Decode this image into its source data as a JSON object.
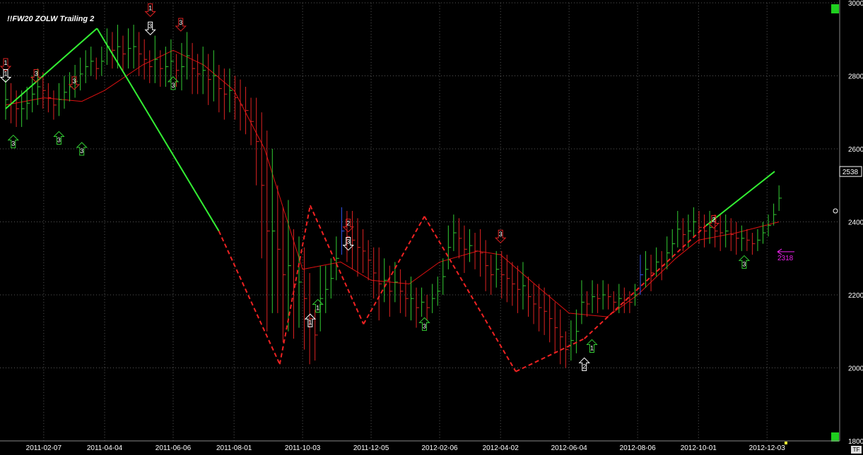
{
  "title": "!!FW20 ZOLW Trailing 2",
  "last_price_label": "2538",
  "target_label": "2318",
  "tf_label": "TF",
  "colors": {
    "background": "#000000",
    "up_bar": "#33cc33",
    "down_bar": "#dd2222",
    "zigzag_up": "#33ee33",
    "zigzag_down": "#ee2222",
    "ma": "#dd1111",
    "grid": "#555555",
    "target": "#ee22ee",
    "neutral_bar": "#3355ee"
  },
  "chart_data": {
    "type": "ohlc",
    "instrument": "!!FW20 ZOLW Trailing 2",
    "xlabels": [
      "2011-02-07",
      "2011-04-04",
      "2011-06-06",
      "2011-08-01",
      "2011-10-03",
      "2011-12-05",
      "2012-02-06",
      "2012-04-02",
      "2012-06-04",
      "2012-08-06",
      "2012-10-01",
      "2012-12-03"
    ],
    "ylabels": [
      3000,
      2800,
      2600,
      2400,
      2200,
      2000,
      1800
    ],
    "ylim": [
      1800,
      3000
    ],
    "grid": true,
    "last_price": 2538,
    "target_price": 2318,
    "price_bars": {
      "date_range": [
        "2011-01-03",
        "2012-12-14"
      ],
      "highs": [
        2790,
        2780,
        2760,
        2760,
        2770,
        2800,
        2820,
        2810,
        2780,
        2760,
        2780,
        2800,
        2810,
        2830,
        2850,
        2870,
        2880,
        2850,
        2880,
        2930,
        2920,
        2940,
        2910,
        2930,
        2940,
        2920,
        2900,
        2870,
        2910,
        2870,
        2880,
        2900,
        2860,
        2890,
        2920,
        2890,
        2860,
        2880,
        2860,
        2870,
        2830,
        2820,
        2820,
        2800,
        2790,
        2770,
        2740,
        2740,
        2700,
        2650,
        2600,
        2500,
        2440,
        2460,
        2380,
        2360,
        2330,
        2260,
        2160,
        2280,
        2280,
        2300,
        2360,
        2440,
        2430,
        2430,
        2410,
        2380,
        2350,
        2330,
        2330,
        2300,
        2280,
        2290,
        2270,
        2240,
        2250,
        2220,
        2220,
        2200,
        2230,
        2250,
        2300,
        2390,
        2420,
        2410,
        2390,
        2380,
        2370,
        2380,
        2350,
        2310,
        2320,
        2320,
        2310,
        2290,
        2280,
        2290,
        2250,
        2230,
        2230,
        2220,
        2200,
        2180,
        2160,
        2100,
        2130,
        2160,
        2240,
        2210,
        2240,
        2230,
        2240,
        2230,
        2210,
        2230,
        2220,
        2210,
        2230,
        2310,
        2320,
        2310,
        2330,
        2320,
        2360,
        2380,
        2430,
        2410,
        2420,
        2440,
        2430,
        2420,
        2430,
        2420,
        2420,
        2420,
        2410,
        2400,
        2390,
        2380,
        2370,
        2380,
        2400,
        2420,
        2450,
        2500
      ],
      "lows": [
        2680,
        2670,
        2660,
        2660,
        2680,
        2700,
        2720,
        2710,
        2700,
        2680,
        2690,
        2710,
        2730,
        2740,
        2760,
        2780,
        2800,
        2790,
        2800,
        2830,
        2820,
        2820,
        2810,
        2820,
        2820,
        2800,
        2790,
        2780,
        2780,
        2770,
        2770,
        2780,
        2770,
        2760,
        2790,
        2750,
        2750,
        2750,
        2720,
        2730,
        2700,
        2680,
        2700,
        2680,
        2650,
        2640,
        2610,
        2500,
        2300,
        2100,
        2150,
        2150,
        2070,
        2100,
        2080,
        2110,
        2050,
        2010,
        2020,
        2100,
        2150,
        2190,
        2240,
        2310,
        2290,
        2270,
        2250,
        2260,
        2240,
        2190,
        2130,
        2180,
        2140,
        2180,
        2150,
        2140,
        2130,
        2110,
        2140,
        2130,
        2150,
        2170,
        2200,
        2270,
        2320,
        2300,
        2260,
        2290,
        2270,
        2250,
        2210,
        2200,
        2220,
        2190,
        2180,
        2170,
        2150,
        2160,
        2140,
        2120,
        2100,
        2090,
        2070,
        2040,
        2010,
        2000,
        2020,
        2040,
        2120,
        2140,
        2150,
        2150,
        2160,
        2160,
        2150,
        2150,
        2150,
        2150,
        2170,
        2200,
        2220,
        2210,
        2250,
        2240,
        2270,
        2300,
        2330,
        2320,
        2330,
        2360,
        2340,
        2330,
        2340,
        2330,
        2320,
        2330,
        2320,
        2310,
        2320,
        2320,
        2310,
        2320,
        2340,
        2360,
        2390,
        2430
      ]
    },
    "zigzag": [
      {
        "date": "2011-01-03",
        "value": 2710,
        "style": "solid",
        "color": "up"
      },
      {
        "date": "2011-03-28",
        "value": 2930,
        "style": "solid",
        "color": "up"
      },
      {
        "date": "2011-07-18",
        "value": 2375,
        "style": "solid",
        "color": "up"
      },
      {
        "date": "2011-09-12",
        "value": 2010,
        "style": "dashed",
        "color": "down"
      },
      {
        "date": "2011-10-10",
        "value": 2445,
        "style": "dashed",
        "color": "down"
      },
      {
        "date": "2011-11-28",
        "value": 2120,
        "style": "dashed",
        "color": "down"
      },
      {
        "date": "2012-01-23",
        "value": 2415,
        "style": "dashed",
        "color": "down"
      },
      {
        "date": "2012-04-16",
        "value": 1990,
        "style": "dashed",
        "color": "down"
      },
      {
        "date": "2012-06-18",
        "value": 2080,
        "style": "dashed",
        "color": "down"
      },
      {
        "date": "2012-10-08",
        "value": 2390,
        "style": "dashed",
        "color": "down"
      },
      {
        "date": "2012-12-10",
        "value": 2538,
        "style": "solid",
        "color": "up"
      }
    ],
    "moving_average": [
      {
        "date": "2011-01-03",
        "value": 2720
      },
      {
        "date": "2011-02-07",
        "value": 2740
      },
      {
        "date": "2011-03-14",
        "value": 2730
      },
      {
        "date": "2011-04-04",
        "value": 2760
      },
      {
        "date": "2011-05-09",
        "value": 2830
      },
      {
        "date": "2011-06-06",
        "value": 2870
      },
      {
        "date": "2011-07-04",
        "value": 2830
      },
      {
        "date": "2011-08-01",
        "value": 2760
      },
      {
        "date": "2011-08-29",
        "value": 2600
      },
      {
        "date": "2011-10-03",
        "value": 2270
      },
      {
        "date": "2011-11-07",
        "value": 2290
      },
      {
        "date": "2011-12-05",
        "value": 2240
      },
      {
        "date": "2012-01-09",
        "value": 2230
      },
      {
        "date": "2012-02-06",
        "value": 2290
      },
      {
        "date": "2012-03-12",
        "value": 2320
      },
      {
        "date": "2012-04-02",
        "value": 2310
      },
      {
        "date": "2012-05-07",
        "value": 2220
      },
      {
        "date": "2012-06-04",
        "value": 2150
      },
      {
        "date": "2012-07-09",
        "value": 2140
      },
      {
        "date": "2012-08-06",
        "value": 2200
      },
      {
        "date": "2012-09-10",
        "value": 2300
      },
      {
        "date": "2012-10-01",
        "value": 2350
      },
      {
        "date": "2012-11-05",
        "value": 2370
      },
      {
        "date": "2012-12-14",
        "value": 2400
      }
    ],
    "signals": [
      {
        "date": "2011-01-03",
        "value": 2830,
        "dir": "down",
        "label": "1",
        "color": "#dd2222"
      },
      {
        "date": "2011-01-03",
        "value": 2800,
        "dir": "down",
        "label": "1",
        "color": "#ffffff"
      },
      {
        "date": "2011-01-10",
        "value": 2620,
        "dir": "up",
        "label": "3",
        "color": "#33cc33"
      },
      {
        "date": "2011-01-31",
        "value": 2800,
        "dir": "down",
        "label": "3",
        "color": "#dd2222"
      },
      {
        "date": "2011-02-21",
        "value": 2630,
        "dir": "up",
        "label": "3",
        "color": "#33cc33"
      },
      {
        "date": "2011-03-07",
        "value": 2780,
        "dir": "down",
        "label": "3",
        "color": "#dd2222"
      },
      {
        "date": "2011-03-14",
        "value": 2600,
        "dir": "up",
        "label": "3",
        "color": "#33cc33"
      },
      {
        "date": "2011-05-16",
        "value": 2980,
        "dir": "down",
        "label": "1",
        "color": "#dd2222"
      },
      {
        "date": "2011-05-16",
        "value": 2930,
        "dir": "down",
        "label": "3",
        "color": "#ffffff"
      },
      {
        "date": "2011-06-13",
        "value": 2940,
        "dir": "down",
        "label": "3",
        "color": "#dd2222"
      },
      {
        "date": "2011-06-06",
        "value": 2780,
        "dir": "up",
        "label": "3",
        "color": "#33cc33"
      },
      {
        "date": "2011-10-10",
        "value": 2130,
        "dir": "up",
        "label": "1",
        "color": "#ffffff"
      },
      {
        "date": "2011-10-17",
        "value": 2170,
        "dir": "up",
        "label": "1",
        "color": "#33cc33"
      },
      {
        "date": "2011-11-14",
        "value": 2390,
        "dir": "down",
        "label": "2",
        "color": "#dd2222"
      },
      {
        "date": "2011-11-14",
        "value": 2340,
        "dir": "down",
        "label": "3",
        "color": "#ffffff"
      },
      {
        "date": "2012-01-23",
        "value": 2120,
        "dir": "up",
        "label": "3",
        "color": "#33cc33"
      },
      {
        "date": "2012-04-02",
        "value": 2360,
        "dir": "down",
        "label": "3",
        "color": "#dd2222"
      },
      {
        "date": "2012-06-18",
        "value": 2010,
        "dir": "up",
        "label": "2",
        "color": "#ffffff"
      },
      {
        "date": "2012-06-25",
        "value": 2060,
        "dir": "up",
        "label": "1",
        "color": "#33cc33"
      },
      {
        "date": "2012-10-15",
        "value": 2400,
        "dir": "down",
        "label": "2",
        "color": "#dd2222"
      },
      {
        "date": "2012-11-12",
        "value": 2290,
        "dir": "up",
        "label": "3",
        "color": "#33cc33"
      }
    ]
  }
}
